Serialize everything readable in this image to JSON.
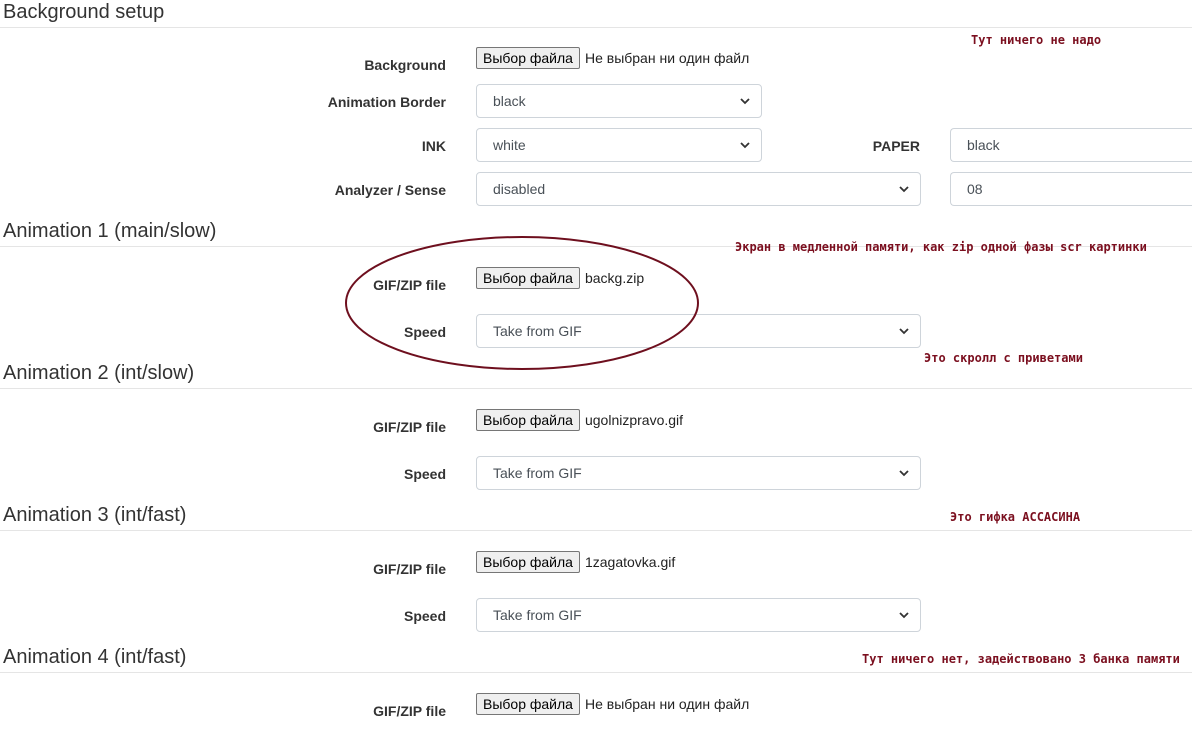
{
  "sections": {
    "background": {
      "title": "Background setup",
      "background_label": "Background",
      "file_button": "Выбор файла",
      "file_name": "Не выбран ни один файл",
      "animation_border_label": "Animation Border",
      "animation_border_value": "black",
      "ink_label": "INK",
      "ink_value": "white",
      "paper_label": "PAPER",
      "paper_value": "black",
      "analyzer_label": "Analyzer / Sense",
      "analyzer_value": "disabled",
      "sense_value": "08"
    },
    "anim1": {
      "title": "Animation 1 (main/slow)",
      "file_label": "GIF/ZIP file",
      "file_button": "Выбор файла",
      "file_name": "backg.zip",
      "speed_label": "Speed",
      "speed_value": "Take from GIF"
    },
    "anim2": {
      "title": "Animation 2 (int/slow)",
      "file_label": "GIF/ZIP file",
      "file_button": "Выбор файла",
      "file_name": "ugolnizpravo.gif",
      "speed_label": "Speed",
      "speed_value": "Take from GIF"
    },
    "anim3": {
      "title": "Animation 3 (int/fast)",
      "file_label": "GIF/ZIP file",
      "file_button": "Выбор файла",
      "file_name": "1zagatovka.gif",
      "speed_label": "Speed",
      "speed_value": "Take from GIF"
    },
    "anim4": {
      "title": "Animation 4 (int/fast)",
      "file_label": "GIF/ZIP file",
      "file_button": "Выбор файла",
      "file_name": "Не выбран ни один файл"
    }
  },
  "annotations": {
    "note1": "Тут ничего не надо",
    "note2": "Экран в медленной памяти, как zip одной фазы scr картинки",
    "note3": "Это скролл с приветами",
    "note4": "Это гифка АССАСИНА",
    "note5": "Тут ничего нет, задействовано 3 банка памяти",
    "annotation_color": "#7b0f1f"
  }
}
